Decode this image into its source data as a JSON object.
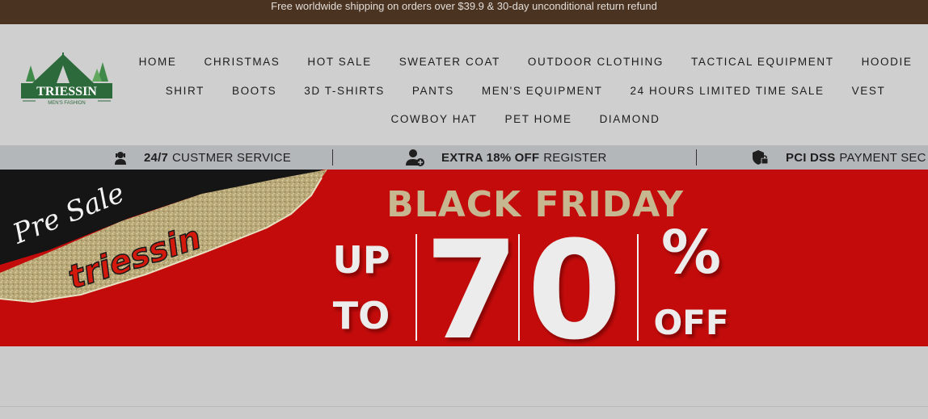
{
  "announcement": "Free worldwide shipping on orders over $39.9 & 30-day unconditional return refund",
  "logo": {
    "name": "TRIESSIN",
    "tagline": "MEN'S FASHION"
  },
  "nav": {
    "row1": [
      "HOME",
      "CHRISTMAS",
      "HOT SALE",
      "SWEATER COAT",
      "OUTDOOR CLOTHING",
      "TACTICAL EQUIPMENT",
      "HOODIE"
    ],
    "row2": [
      "SHIRT",
      "BOOTS",
      "3D T-SHIRTS",
      "PANTS",
      "MEN'S EQUIPMENT",
      "24 HOURS LIMITED TIME SALE",
      "VEST"
    ],
    "row3": [
      "COWBOY HAT",
      "PET HOME",
      "DIAMOND"
    ]
  },
  "trust_bar": [
    {
      "bold": "24/7",
      "text": "CUSTMER SERVICE",
      "icon": "support-agent-icon"
    },
    {
      "bold": "EXTRA 18% OFF",
      "text": "REGISTER",
      "icon": "user-add-icon"
    },
    {
      "bold": "PCI DSS",
      "text": "PAYMENT SEC",
      "icon": "shield-lock-icon"
    }
  ],
  "banner": {
    "script_text": "Pre Sale",
    "brand_text": "triessin",
    "headline": "BLACK FRIDAY",
    "up": "UP",
    "to": "TO",
    "number": "70",
    "percent": "%",
    "off": "OFF"
  },
  "colors": {
    "announcement_bg": "#4a3321",
    "header_bg": "#cfcfcf",
    "trust_bg": "#b4b7ba",
    "banner_red": "#c40b0b",
    "logo_green": "#2d6a3b",
    "gold": "#b9a877"
  }
}
